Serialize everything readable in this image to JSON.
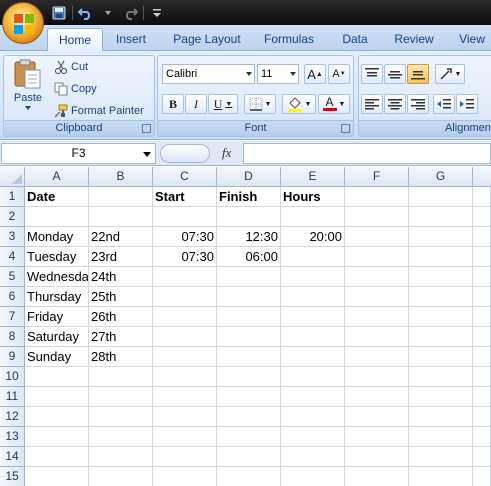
{
  "quick_access": {
    "icons": [
      "save-icon",
      "undo-icon",
      "redo-icon",
      "customize-qat-icon"
    ]
  },
  "ribbon": {
    "tabs": [
      "Home",
      "Insert",
      "Page Layout",
      "Formulas",
      "Data",
      "Review",
      "View"
    ],
    "active_tab": "Home",
    "clipboard": {
      "paste_label": "Paste",
      "cut_label": "Cut",
      "copy_label": "Copy",
      "format_painter_label": "Format Painter",
      "group_label": "Clipboard"
    },
    "font": {
      "font_name": "Calibri",
      "font_size": "11",
      "grow_label": "A",
      "shrink_label": "A",
      "bold_label": "B",
      "italic_label": "I",
      "underline_label": "U",
      "font_color_label": "A",
      "group_label": "Font"
    },
    "alignment": {
      "group_label": "Alignmen"
    }
  },
  "formula_bar": {
    "name_box": "F3",
    "fx_label": "fx",
    "formula": ""
  },
  "sheet": {
    "columns": [
      "A",
      "B",
      "C",
      "D",
      "E",
      "F",
      "G"
    ],
    "rows": [
      "1",
      "2",
      "3",
      "4",
      "5",
      "6",
      "7",
      "8",
      "9",
      "10",
      "11",
      "12",
      "13",
      "14",
      "15"
    ],
    "cells": {
      "A1": "Date",
      "C1": "Start",
      "D1": "Finish",
      "E1": "Hours",
      "A3": "Monday",
      "B3": "22nd",
      "C3": "07:30",
      "D3": "12:30",
      "E3": "20:00",
      "A4": "Tuesday",
      "B4": "23rd",
      "C4": "07:30",
      "D4": "06:00",
      "A5": "Wednesday",
      "B5": "24th",
      "A6": "Thursday",
      "B6": "25th",
      "A7": "Friday",
      "B7": "26th",
      "A8": "Saturday",
      "B8": "27th",
      "A9": "Sunday",
      "B9": "28th"
    },
    "selected_cell": "F3"
  }
}
